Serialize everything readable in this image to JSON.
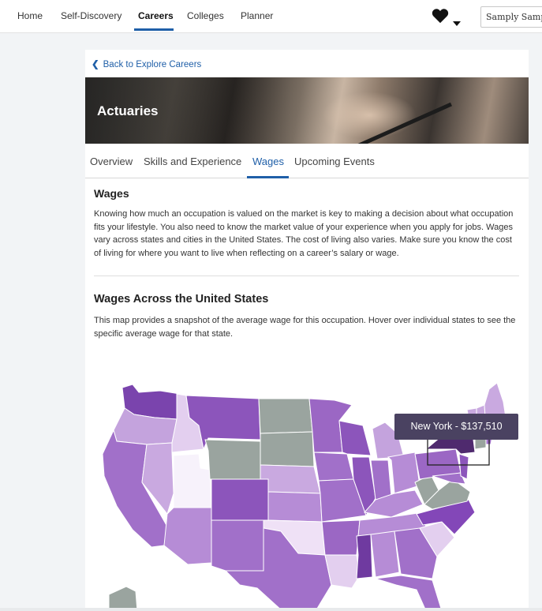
{
  "nav": {
    "items": [
      {
        "label": "Home"
      },
      {
        "label": "Self-Discovery"
      },
      {
        "label": "Careers"
      },
      {
        "label": "Colleges"
      },
      {
        "label": "Planner"
      }
    ],
    "active": "Careers",
    "user_name": "Samply Sample"
  },
  "icons": {
    "favorites": "heart-icon",
    "menu": "caret-down-icon",
    "back": "chevron-left-icon"
  },
  "page": {
    "back_link": "Back to Explore Careers",
    "title": "Actuaries",
    "tabs": [
      {
        "label": "Overview"
      },
      {
        "label": "Skills and Experience"
      },
      {
        "label": "Wages"
      },
      {
        "label": "Upcoming Events"
      }
    ],
    "active_tab": "Wages"
  },
  "wages": {
    "heading": "Wages",
    "body": "Knowing how much an occupation is valued on the market is key to making a decision about what occupation fits your lifestyle. You also need to know the market value of your experience when you apply for jobs. Wages vary across states and cities in the United States. The cost of living also varies. Make sure you know the cost of living for where you want to live when reflecting on a career’s salary or wage."
  },
  "map_section": {
    "heading": "Wages Across the United States",
    "body": "This map provides a snapshot of the average wage for this occupation. Hover over individual states to see the specific average wage for that state.",
    "tooltip": "New York - $137,510",
    "hovered_state": "New York"
  },
  "colors": {
    "accent": "#1f5fa8",
    "tooltip_bg": "#4a4261",
    "no_data": "#9aa49f",
    "purple_scale": [
      "#f7f2fb",
      "#e3cfef",
      "#c9a9e0",
      "#b68cd6",
      "#a170c9",
      "#8c55bb",
      "#6f3aa0",
      "#4f2a6e"
    ]
  }
}
